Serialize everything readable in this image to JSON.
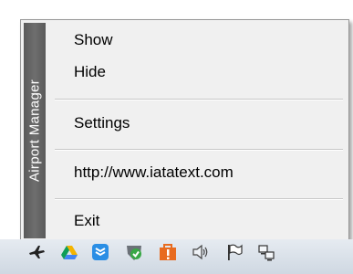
{
  "menu": {
    "side_title": "Airport Manager",
    "items": [
      {
        "label": "Show"
      },
      {
        "label": "Hide"
      },
      {
        "label": "Settings"
      },
      {
        "label": "http://www.iatatext.com"
      },
      {
        "label": "Exit"
      }
    ]
  },
  "tray": {
    "icons": [
      "airplane-icon",
      "google-drive-icon",
      "dropbox-icon",
      "security-shield-icon",
      "office-warning-icon",
      "speaker-icon",
      "flag-icon",
      "network-icon"
    ]
  },
  "colors": {
    "menu_bg": "#f0f0f0",
    "side_band": "#666666",
    "tray_bg": "#d8e0ea"
  }
}
